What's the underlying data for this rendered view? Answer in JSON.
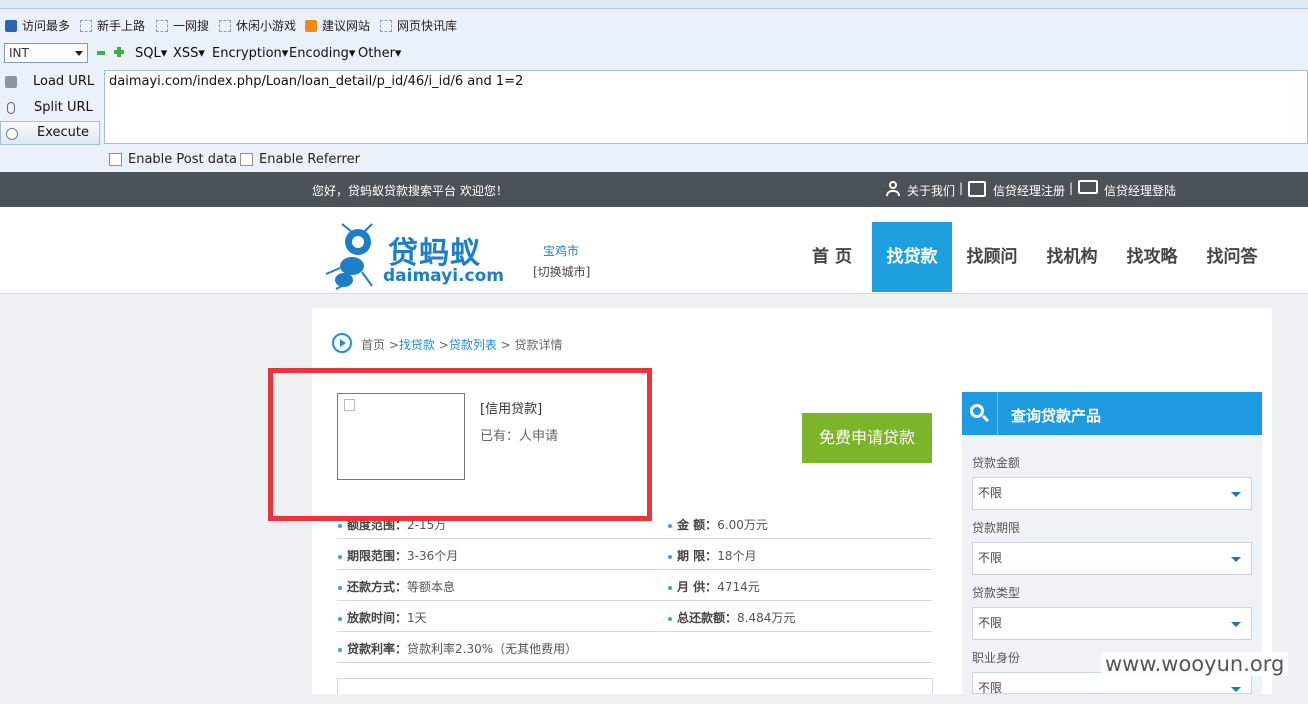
{
  "bookmarks": [
    {
      "label": "访问最多"
    },
    {
      "label": "新手上路"
    },
    {
      "label": "一网搜"
    },
    {
      "label": "休闲小游戏"
    },
    {
      "label": "建议网站"
    },
    {
      "label": "网页快讯库"
    }
  ],
  "hackbar": {
    "type_select": "INT",
    "menus": [
      "SQL▾",
      "XSS▾",
      "Encryption▾",
      "Encoding▾",
      "Other▾"
    ],
    "load_url": "Load URL",
    "split_url": "Split URL",
    "execute": "Execute",
    "url": "daimayi.com/index.php/Loan/loan_detail/p_id/46/i_id/6 and 1=2",
    "enable_post": "Enable Post data",
    "enable_referrer": "Enable Referrer"
  },
  "topbar": {
    "welcome": "您好，贷蚂蚁贷款搜索平台 欢迎您！",
    "about": "关于我们",
    "sep1": "|",
    "register": "信贷经理注册",
    "sep2": "|",
    "login": "信贷经理登陆"
  },
  "header": {
    "logo_cn": "贷蚂蚁",
    "logo_en": "daimayi.com",
    "city": "宝鸡市",
    "switch_city": "[切换城市]",
    "nav": [
      "首 页",
      "找贷款",
      "找顾问",
      "找机构",
      "找攻略",
      "找问答"
    ]
  },
  "breadcrumb": {
    "home": "首页",
    "sep": ">",
    "find_loan": "找贷款",
    "loan_list": "贷款列表",
    "current": "贷款详情"
  },
  "product": {
    "category": "[信用贷款]",
    "applied": "已有：人申请",
    "apply_button": "免费申请贷款"
  },
  "details": {
    "quota_label": "额度范围：",
    "quota_value": "2-15万",
    "amount_label": "金 额：",
    "amount_value": "6.00万元",
    "term_range_label": "期限范围：",
    "term_range_value": "3-36个月",
    "term_label": "期 限：",
    "term_value": "18个月",
    "repay_label": "还款方式：",
    "repay_value": "等额本息",
    "monthly_label": "月 供：",
    "monthly_value": "4714元",
    "release_label": "放款时间：",
    "release_value": "1天",
    "total_label": "总还款额：",
    "total_value": "8.484万元",
    "rate_label": "贷款利率：",
    "rate_value": "贷款利率2.30%（无其他费用）"
  },
  "side": {
    "title": "查询贷款产品",
    "fields": [
      {
        "label": "贷款金额",
        "value": "不限"
      },
      {
        "label": "贷款期限",
        "value": "不限"
      },
      {
        "label": "贷款类型",
        "value": "不限"
      },
      {
        "label": "职业身份",
        "value": "不限"
      }
    ]
  },
  "watermark": "www.wooyun.org",
  "colors": {
    "accent": "#1ea0df",
    "apply_green": "#7cb42a",
    "highlight_red": "#e8343a",
    "topbar": "#4b5257"
  }
}
